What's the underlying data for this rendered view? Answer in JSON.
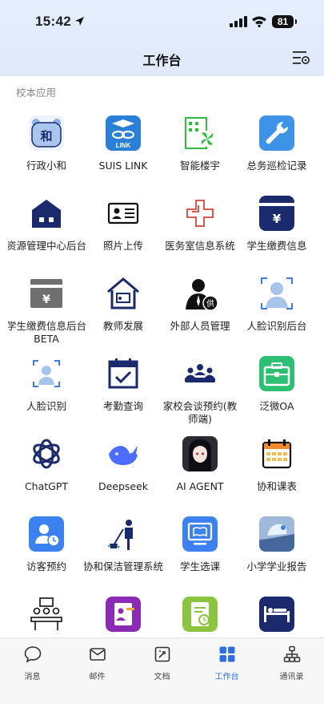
{
  "status_bar": {
    "time": "15:42",
    "battery": "81"
  },
  "header": {
    "title": "工作台"
  },
  "section": {
    "label": "校本应用"
  },
  "apps": [
    {
      "label": "行政小和",
      "icon": "he-mascot-icon"
    },
    {
      "label": "SUIS LINK",
      "icon": "suis-link-icon",
      "badge": "LINK"
    },
    {
      "label": "智能楼宇",
      "icon": "smart-building-icon"
    },
    {
      "label": "总务巡检记录",
      "icon": "wrench-icon"
    },
    {
      "label": "资源管理中心后台",
      "icon": "resource-house-icon"
    },
    {
      "label": "照片上传",
      "icon": "id-card-icon"
    },
    {
      "label": "医务室信息系统",
      "icon": "medical-cross-icon"
    },
    {
      "label": "学生缴费信息",
      "icon": "payment-yen-icon"
    },
    {
      "label": "学生缴费信息后台BETA",
      "icon": "payment-yen-gray-icon"
    },
    {
      "label": "教师发展",
      "icon": "teacher-house-icon"
    },
    {
      "label": "外部人员管理",
      "icon": "visitor-person-icon",
      "badge": "供"
    },
    {
      "label": "人脸识别后台",
      "icon": "face-admin-icon"
    },
    {
      "label": "人脸识别",
      "icon": "face-scan-icon"
    },
    {
      "label": "考勤查询",
      "icon": "attendance-calendar-icon"
    },
    {
      "label": "家校会谈预约(教师端)",
      "icon": "meeting-icon"
    },
    {
      "label": "泛微OA",
      "icon": "toolbox-icon"
    },
    {
      "label": "ChatGPT",
      "icon": "chatgpt-icon"
    },
    {
      "label": "Deepseek",
      "icon": "deepseek-whale-icon"
    },
    {
      "label": "AI AGENT",
      "icon": "ai-agent-avatar-icon"
    },
    {
      "label": "协和课表",
      "icon": "timetable-calendar-icon"
    },
    {
      "label": "访客预约",
      "icon": "visitor-booking-icon"
    },
    {
      "label": "协和保洁管理系统",
      "icon": "cleaning-icon"
    },
    {
      "label": "学生选课",
      "icon": "course-select-icon"
    },
    {
      "label": "小学学业报告",
      "icon": "report-icon"
    },
    {
      "label": "",
      "icon": "conference-icon"
    },
    {
      "label": "",
      "icon": "contact-card-icon"
    },
    {
      "label": "",
      "icon": "document-clock-icon"
    },
    {
      "label": "",
      "icon": "dormitory-bed-icon"
    }
  ],
  "tabs": [
    {
      "label": "消息",
      "icon": "chat-bubble-icon",
      "active": false
    },
    {
      "label": "邮件",
      "icon": "mail-icon",
      "active": false
    },
    {
      "label": "文档",
      "icon": "document-icon",
      "active": false
    },
    {
      "label": "工作台",
      "icon": "workbench-grid-icon",
      "active": true
    },
    {
      "label": "通讯录",
      "icon": "org-chart-icon",
      "active": false
    }
  ],
  "colors": {
    "accent": "#2f6ee8",
    "header_bg": "#e4eefc",
    "navy": "#1a2a6c"
  }
}
